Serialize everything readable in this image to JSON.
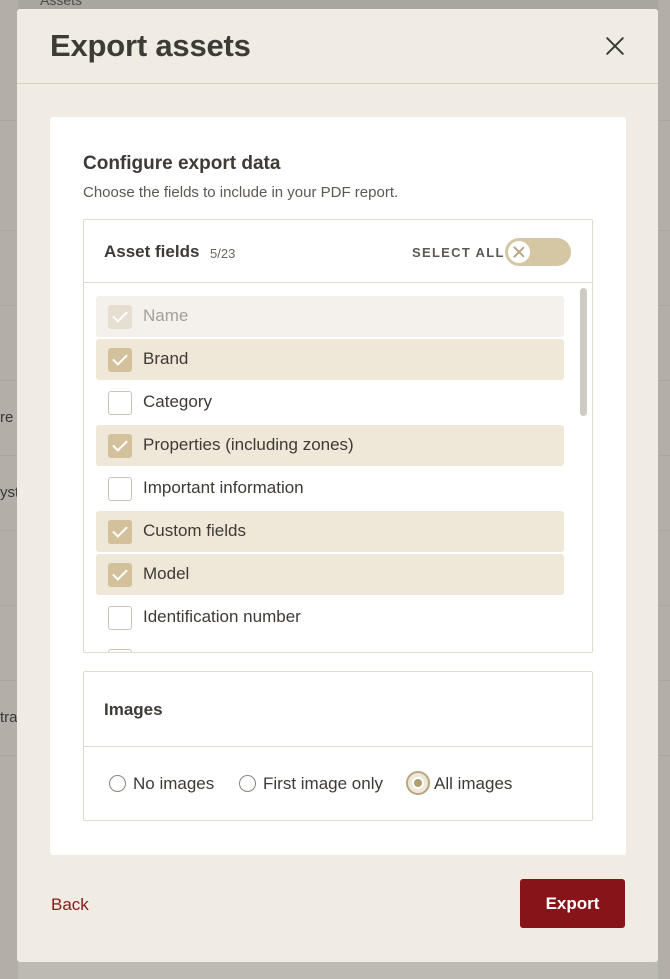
{
  "background": {
    "breadcrumb": "Assets",
    "row_fragments": [
      "re",
      "yst",
      "tra"
    ]
  },
  "modal": {
    "title": "Export assets",
    "close_label": "Close"
  },
  "config": {
    "title": "Configure export data",
    "subtitle": "Choose the fields to include in your PDF report."
  },
  "fields": {
    "label": "Asset fields",
    "count": "5/23",
    "select_all_label": "SELECT ALL",
    "select_all_on": false,
    "items": [
      {
        "label": "Name",
        "checked": true,
        "disabled": true
      },
      {
        "label": "Brand",
        "checked": true,
        "disabled": false
      },
      {
        "label": "Category",
        "checked": false,
        "disabled": false
      },
      {
        "label": "Properties (including zones)",
        "checked": true,
        "disabled": false
      },
      {
        "label": "Important information",
        "checked": false,
        "disabled": false
      },
      {
        "label": "Custom fields",
        "checked": true,
        "disabled": false
      },
      {
        "label": "Model",
        "checked": true,
        "disabled": false
      },
      {
        "label": "Identification number",
        "checked": false,
        "disabled": false
      },
      {
        "label": "",
        "checked": false,
        "disabled": false
      }
    ]
  },
  "images": {
    "label": "Images",
    "options": [
      {
        "label": "No images",
        "selected": false
      },
      {
        "label": "First image only",
        "selected": false
      },
      {
        "label": "All images",
        "selected": true
      }
    ]
  },
  "footer": {
    "back_label": "Back",
    "export_label": "Export"
  },
  "colors": {
    "accent": "#861418",
    "checked_fill": "#d3c19b",
    "row_highlight": "#efe7d8",
    "modal_bg": "#f1ece3"
  }
}
